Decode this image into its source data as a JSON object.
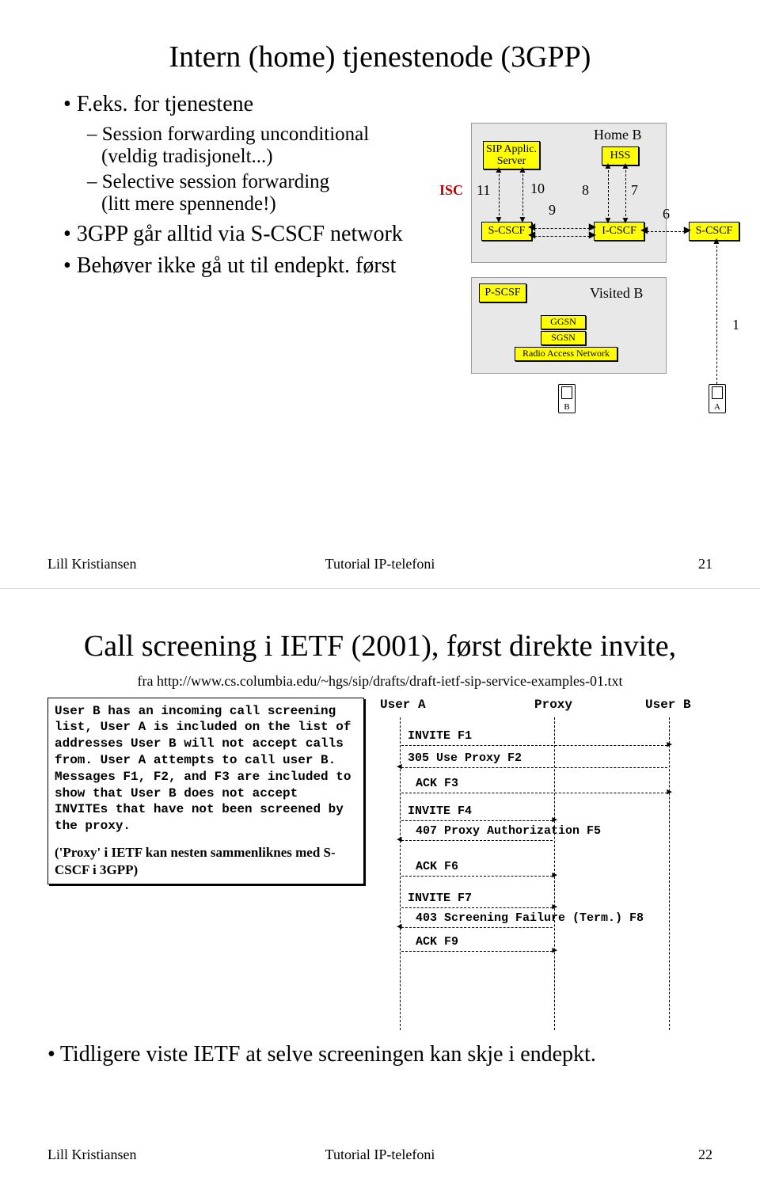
{
  "slide1": {
    "title": "Intern (home)  tjenestenode (3GPP)",
    "bullets": {
      "b1a": "F.eks. for tjenestene",
      "b2a": "Session forwarding unconditional",
      "b2a_paren": "(veldig tradisjonelt...)",
      "b2b": "Selective session forwarding",
      "b2b_paren": "(litt mere spennende!)",
      "b1b": "3GPP går alltid via S-CSCF network",
      "b1c": "Behøver ikke gå ut til endepkt. først"
    },
    "diagram": {
      "isc": "ISC",
      "home_b": "Home B",
      "visited_b": "Visited B",
      "sip_applic": "SIP Applic. Server",
      "hss": "HSS",
      "s_cscf": "S-CSCF",
      "i_cscf": "I-CSCF",
      "p_scsf": "P-SCSF",
      "ggsn": "GGSN",
      "sgsn": "SGSN",
      "ran": "Radio Access Network",
      "s_cscf_right": "S-CSCF",
      "phone_b": "B",
      "phone_a": "A",
      "n6": "6",
      "n7": "7",
      "n8": "8",
      "n9": "9",
      "n10": "10",
      "n11": "11",
      "n1": "1"
    },
    "footer": {
      "left": "Lill Kristiansen",
      "center": "Tutorial IP-telefoni",
      "right": "21"
    }
  },
  "slide2": {
    "title": "Call screening i IETF (2001), først direkte invite,",
    "subtitle": "fra http://www.cs.columbia.edu/~hgs/sip/drafts/draft-ietf-sip-service-examples-01.txt",
    "textbox": "User B has an incoming call screening list, User A is included on the list of addresses User B will not accept calls from. User A attempts to call user B. Messages F1, F2, and F3 are included to show that User B does not accept INVITEs that have not been screened by the proxy.",
    "note": "('Proxy' i IETF kan nesten sammenliknes med S-CSCF i 3GPP)",
    "seq": {
      "user_a": "User A",
      "proxy": "Proxy",
      "user_b": "User B",
      "m1": "INVITE F1",
      "m2": "305 Use Proxy F2",
      "m3": "ACK F3",
      "m4": "INVITE F4",
      "m5": "407 Proxy Authorization F5",
      "m6": "ACK F6",
      "m7": "INVITE F7",
      "m8": "403 Screening Failure (Term.) F8",
      "m9": "ACK F9"
    },
    "conclusion": "Tidligere viste IETF at selve screeningen kan skje i endepkt.",
    "footer": {
      "left": "Lill Kristiansen",
      "center": "Tutorial IP-telefoni",
      "right": "22"
    }
  }
}
